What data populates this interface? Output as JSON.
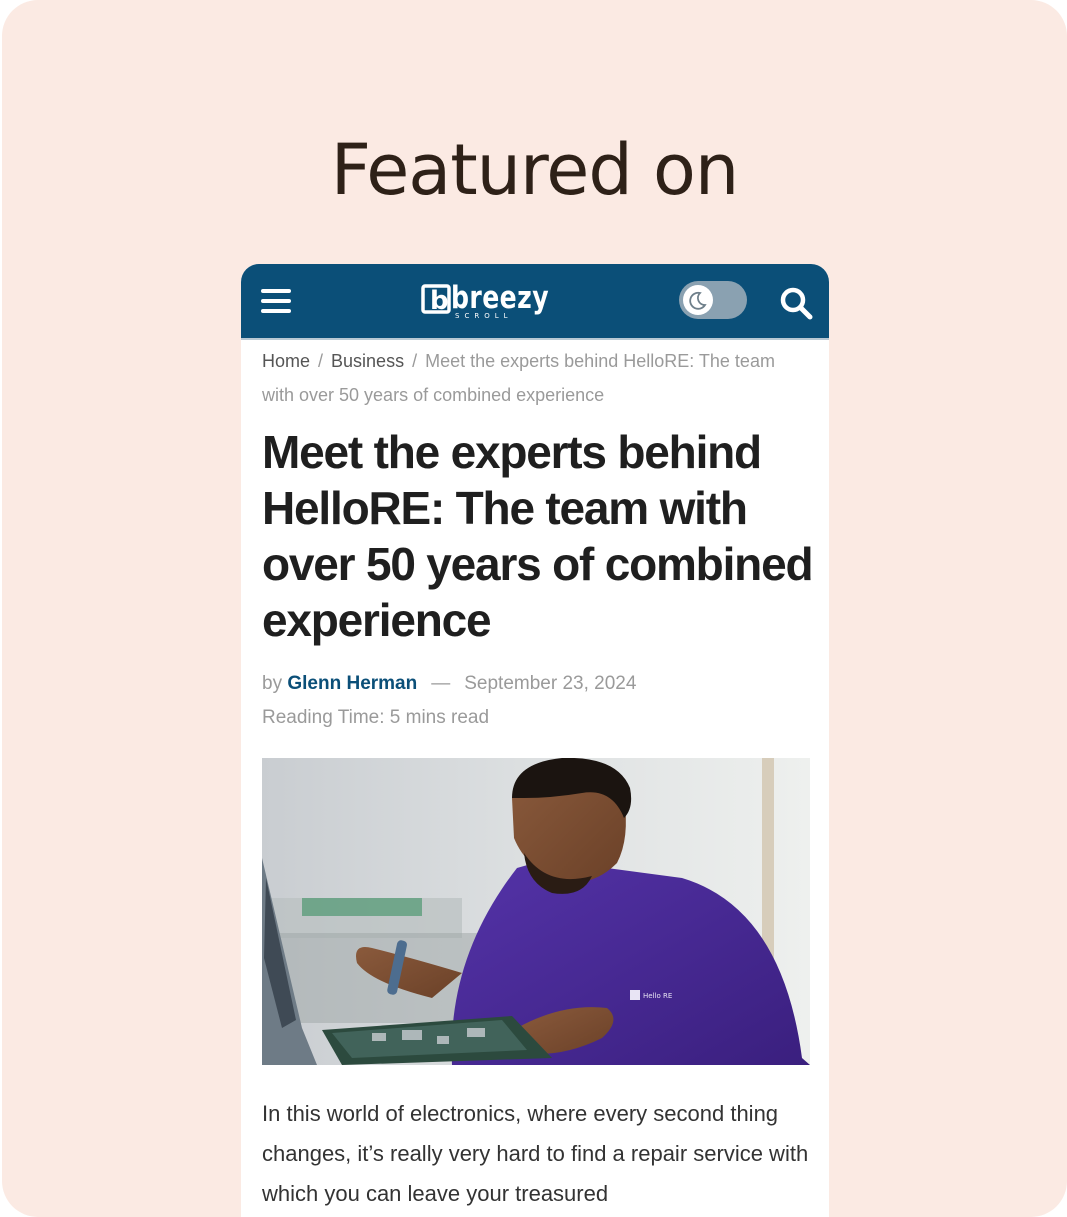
{
  "heading": "Featured on",
  "site": {
    "logo_text": "breezy",
    "logo_subtext": "SCROLL"
  },
  "breadcrumb": {
    "home": "Home",
    "separator": "/",
    "category": "Business",
    "current": "Meet the experts behind HelloRE: The team with over 50 years of combined experience"
  },
  "article": {
    "title": "Meet the experts behind HelloRE: The team with over 50 years of combined experience",
    "by_label": "by",
    "author": "Glenn Herman",
    "dash": "—",
    "date": "September 23, 2024",
    "reading_time": "Reading Time: 5 mins read",
    "image_alt": "Technician in a purple HelloRE polo shirt repairing an electronic circuit board",
    "shirt_logo_text": "Hello RE",
    "body": "In this world of electronics, where every second thing changes, it’s really very hard to find a repair service with which you can leave your treasured"
  },
  "colors": {
    "card_background": "#fbeae3",
    "header_blue": "#0b4f78",
    "author_link": "#0b4f78",
    "shirt_purple": "#4a2a93"
  },
  "icons": {
    "menu": "hamburger-menu-icon",
    "dark_mode": "moon-icon",
    "search": "search-icon"
  }
}
